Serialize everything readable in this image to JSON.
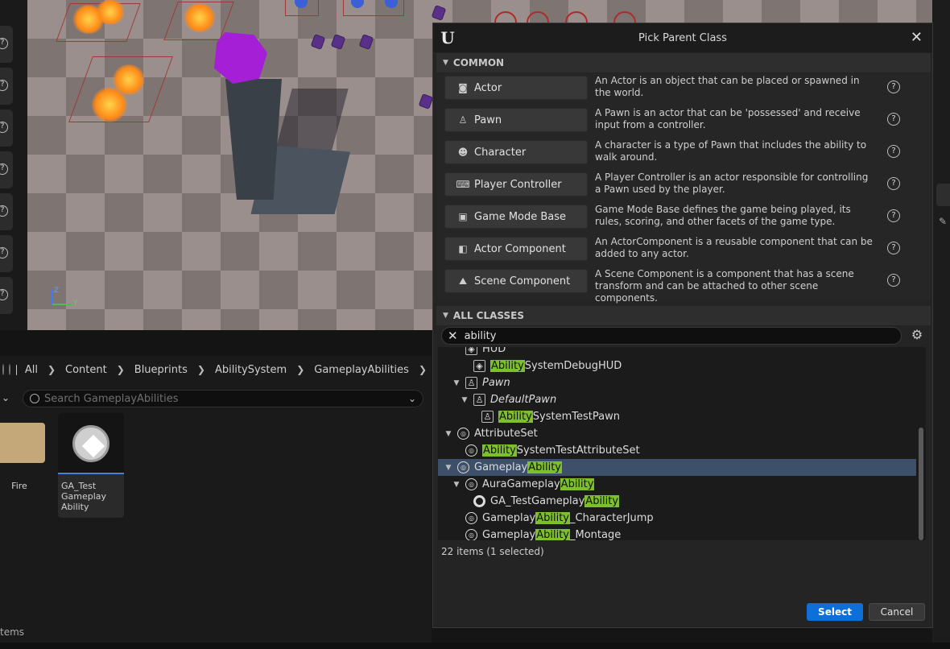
{
  "dialog": {
    "title": "Pick Parent Class",
    "common_section": "COMMON",
    "all_classes_section": "ALL CLASSES",
    "common_classes": [
      {
        "label": "Actor",
        "icon": "actor-icon",
        "description": "An Actor is an object that can be placed or spawned in the world."
      },
      {
        "label": "Pawn",
        "icon": "pawn-icon",
        "description": "A Pawn is an actor that can be 'possessed' and receive input from a controller."
      },
      {
        "label": "Character",
        "icon": "character-icon",
        "description": "A character is a type of Pawn that includes the ability to walk around."
      },
      {
        "label": "Player Controller",
        "icon": "gamepad-icon",
        "description": "A Player Controller is an actor responsible for controlling a Pawn used by the player."
      },
      {
        "label": "Game Mode Base",
        "icon": "game-mode-icon",
        "description": "Game Mode Base defines the game being played, its rules, scoring, and other facets of the game type."
      },
      {
        "label": "Actor Component",
        "icon": "actor-component-icon",
        "description": "An ActorComponent is a reusable component that can be added to any actor."
      },
      {
        "label": "Scene Component",
        "icon": "scene-component-icon",
        "description": "A Scene Component is a component that has a scene transform and can be attached to other scene components."
      }
    ],
    "search": {
      "value": "ability"
    },
    "tree": [
      {
        "pre": "HUD",
        "hl": "",
        "post": "",
        "indent": 2,
        "arrow": "none",
        "icon": "hud-icon",
        "italic": false
      },
      {
        "pre": "",
        "hl": "Ability",
        "post": "SystemDebugHUD",
        "indent": 3,
        "arrow": "none",
        "icon": "hud-icon",
        "italic": false
      },
      {
        "pre": "Pawn",
        "hl": "",
        "post": "",
        "indent": 2,
        "arrow": "open",
        "icon": "pawn-icon",
        "italic": true
      },
      {
        "pre": "DefaultPawn",
        "hl": "",
        "post": "",
        "indent": 3,
        "arrow": "open",
        "icon": "pawn-icon",
        "italic": true
      },
      {
        "pre": "",
        "hl": "Ability",
        "post": "SystemTestPawn",
        "indent": 4,
        "arrow": "none",
        "icon": "pawn-icon",
        "italic": false
      },
      {
        "pre": "AttributeSet",
        "hl": "",
        "post": "",
        "indent": 1,
        "arrow": "open",
        "icon": "object-icon",
        "italic": false
      },
      {
        "pre": "",
        "hl": "Ability",
        "post": "SystemTestAttributeSet",
        "indent": 2,
        "arrow": "none",
        "icon": "object-icon",
        "italic": false
      },
      {
        "pre": "Gameplay",
        "hl": "Ability",
        "post": "",
        "indent": 1,
        "arrow": "open",
        "icon": "object-icon",
        "italic": false,
        "selected": true
      },
      {
        "pre": "AuraGameplay",
        "hl": "Ability",
        "post": "",
        "indent": 2,
        "arrow": "open",
        "icon": "object-icon",
        "italic": false
      },
      {
        "pre": "GA_TestGameplay",
        "hl": "Ability",
        "post": "",
        "indent": 3,
        "arrow": "none",
        "icon": "blueprint-ring-icon",
        "italic": false
      },
      {
        "pre": "Gameplay",
        "hl": "Ability",
        "post": "_CharacterJump",
        "indent": 2,
        "arrow": "none",
        "icon": "object-icon",
        "italic": false
      },
      {
        "pre": "Gameplay",
        "hl": "Ability",
        "post": "_Montage",
        "indent": 2,
        "arrow": "none",
        "icon": "object-icon",
        "italic": false
      }
    ],
    "item_count": "22 items (1 selected)",
    "select_label": "Select",
    "cancel_label": "Cancel"
  },
  "content_browser": {
    "breadcrumbs": [
      "All",
      "Content",
      "Blueprints",
      "AbilitySystem",
      "GameplayAbilities"
    ],
    "search_placeholder": "Search GameplayAbilities",
    "folder_label": "Fire",
    "asset_label": "GA_Test\nGameplay\nAbility",
    "status": "tems"
  },
  "viewport": {
    "axis_z": "Z",
    "axis_y": "Y"
  }
}
